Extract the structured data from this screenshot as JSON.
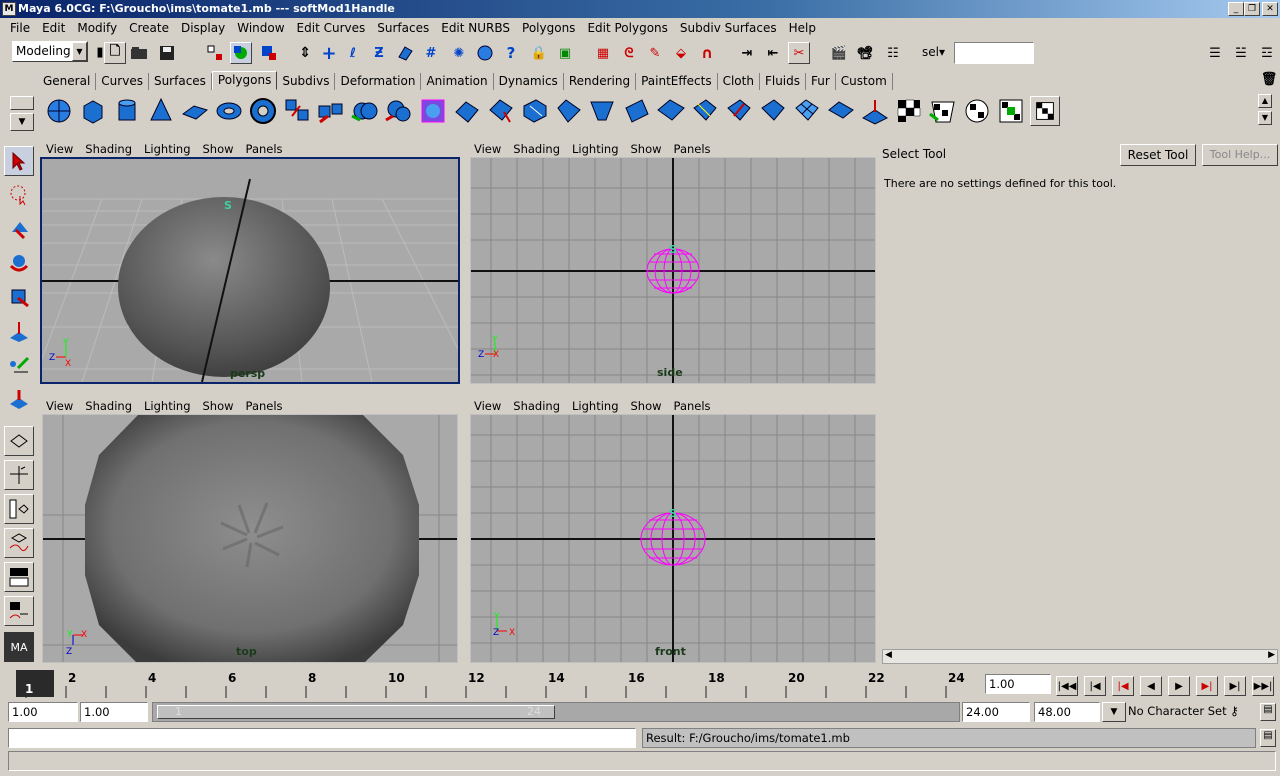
{
  "window": {
    "title": "Maya 6.0CG: F:\\Groucho\\ims\\tomate1.mb   ---   softMod1Handle",
    "icon": "maya-logo-icon",
    "buttons": [
      "_",
      "❐",
      "✕"
    ]
  },
  "menubar": [
    "File",
    "Edit",
    "Modify",
    "Create",
    "Display",
    "Window",
    "Edit Curves",
    "Surfaces",
    "Edit NURBS",
    "Polygons",
    "Edit Polygons",
    "Subdiv Surfaces",
    "Help"
  ],
  "statusline": {
    "menuset": "Modeling",
    "sel_label": "sel▾",
    "input_value": ""
  },
  "shelf": {
    "tabs": [
      "General",
      "Curves",
      "Surfaces",
      "Polygons",
      "Subdivs",
      "Deformation",
      "Animation",
      "Dynamics",
      "Rendering",
      "PaintEffects",
      "Cloth",
      "Fluids",
      "Fur",
      "Custom"
    ],
    "active": "Polygons"
  },
  "panels": {
    "menu": [
      "View",
      "Shading",
      "Lighting",
      "Show",
      "Panels"
    ],
    "persp": {
      "label": "persp"
    },
    "side": {
      "label": "side"
    },
    "top": {
      "label": "top"
    },
    "front": {
      "label": "front"
    },
    "handle_glyph": "S",
    "axis": {
      "y": "Y",
      "z": "Z",
      "x": "X"
    }
  },
  "toolsettings": {
    "title": "Select Tool",
    "reset": "Reset Tool",
    "help": "Tool Help...",
    "message": "There are no settings defined for this tool."
  },
  "timeslider": {
    "ticks": [
      "2",
      "4",
      "6",
      "8",
      "10",
      "12",
      "14",
      "16",
      "18",
      "20",
      "22",
      "24"
    ],
    "current_frame": "1",
    "current_time_field": "1.00"
  },
  "range": {
    "start": "1.00",
    "playback_start": "1.00",
    "range_start": "1",
    "range_end": "24",
    "playback_end": "24.00",
    "end": "48.00",
    "character_set": "No Character Set"
  },
  "commandline": {
    "input": "",
    "result": "Result: F:/Groucho/ims/tomate1.mb"
  },
  "colors": {
    "selection": "#ff00ff",
    "viewport": "#a9a9a9",
    "accent": "#0a246a"
  }
}
